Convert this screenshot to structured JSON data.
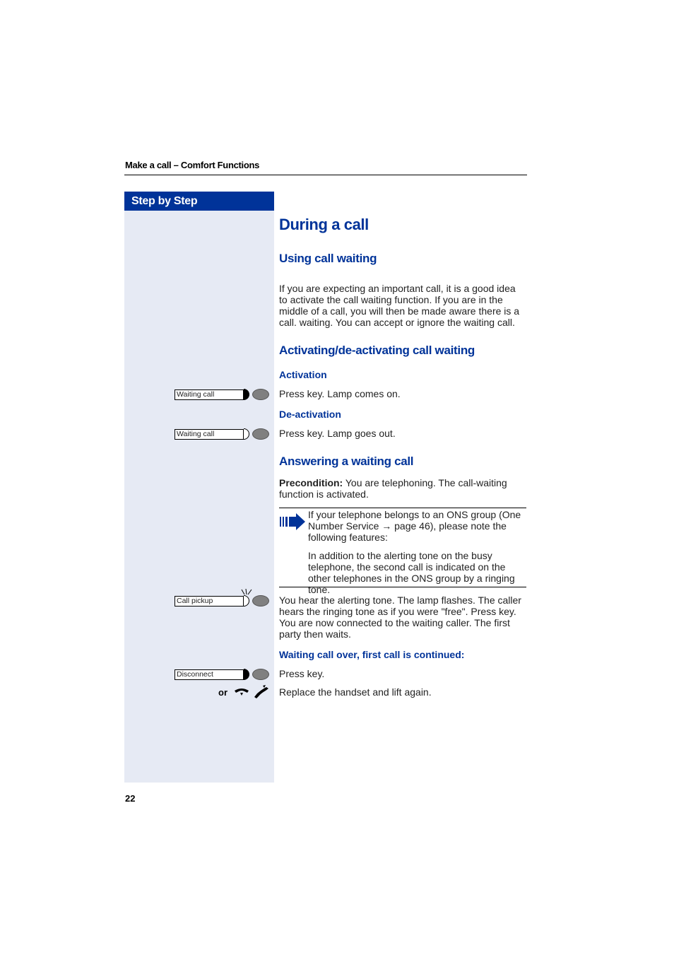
{
  "header": {
    "title": "Make a call – Comfort Functions"
  },
  "sidebar": {
    "title": "Step by Step"
  },
  "page_number": "22",
  "main": {
    "title": "During a call",
    "section1": {
      "heading": "Using call waiting",
      "paragraph": "If you are expecting an important call, it is a good idea to activate the call waiting function. If you are in the middle of a call, you will then be made aware there is a call. waiting. You can accept or ignore the waiting call."
    },
    "section2": {
      "heading": "Activating/de-activating call waiting",
      "activation_label": "Activation",
      "activation_text": "Press key. Lamp comes on.",
      "deactivation_label": "De-activation",
      "deactivation_text": "Press key. Lamp goes out."
    },
    "section3": {
      "heading": "Answering a waiting call",
      "precondition_label": "Precondition:",
      "precondition_text": " You are telephoning. The call-waiting function is activated.",
      "note_line1": "If your telephone belongs to an ONS group (One Number Service → page 46), please note the following features:",
      "note_line2": "In addition to the alerting tone on the busy telephone, the second call is indicated on the other telephones in the ONS group by a ringing tone.",
      "pickup_text": "You hear the alerting tone. The lamp flashes. The caller hears the ringing tone as if you were \"free\". Press key. You are now connected to the waiting caller. The first party then waits.",
      "subheading": "Waiting call over, first call is continued:",
      "disconnect_text": "Press key.",
      "handset_text": "Replace the handset and lift again."
    }
  },
  "keys": {
    "waiting_call_on": "Waiting call",
    "waiting_call_off": "Waiting call",
    "call_pickup": "Call pickup",
    "disconnect": "Disconnect",
    "or_label": "or"
  }
}
